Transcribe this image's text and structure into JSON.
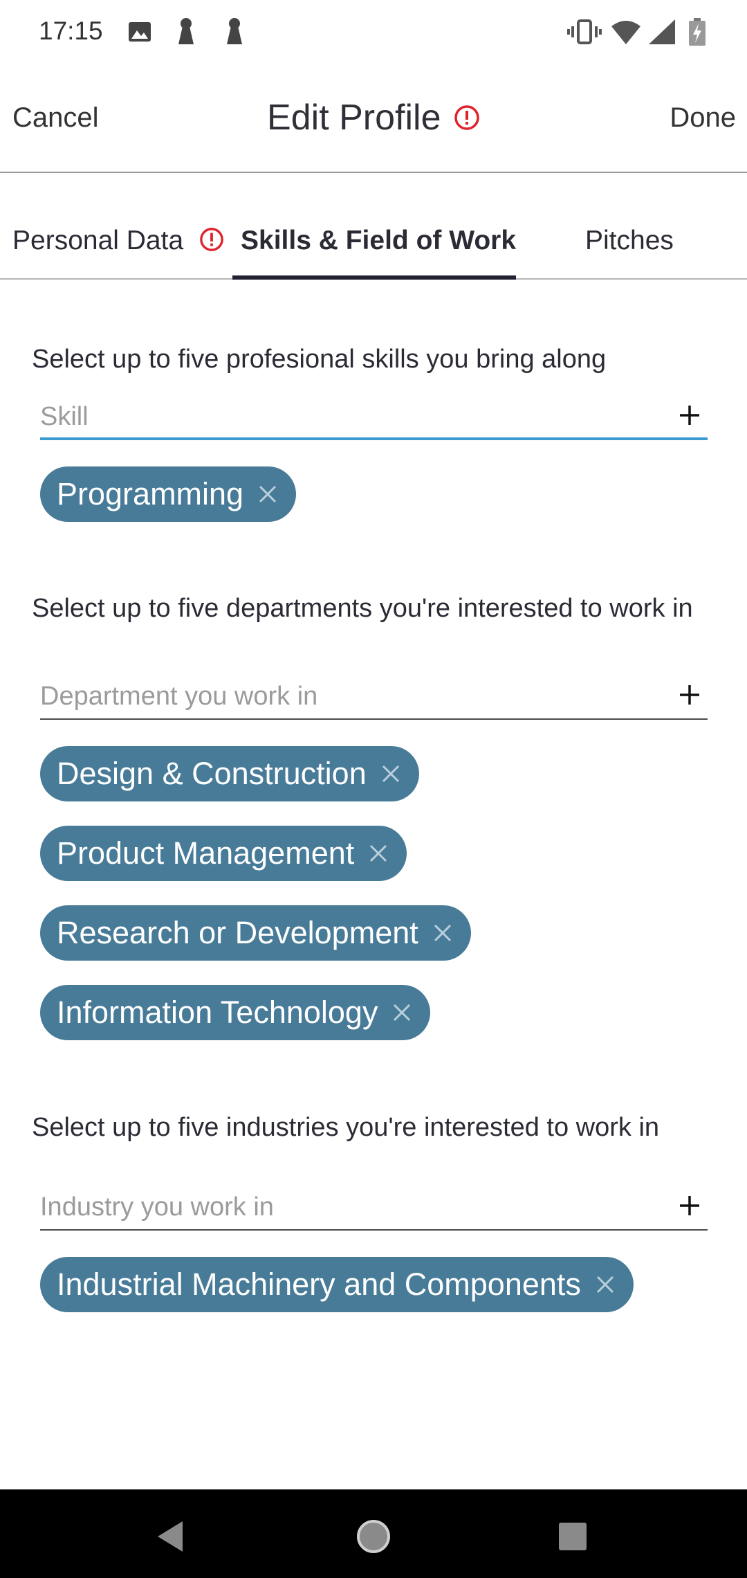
{
  "status_bar": {
    "time": "17:15",
    "icons": [
      "gallery-icon",
      "key-icon",
      "key-icon",
      "vibrate-icon",
      "wifi-icon",
      "signal-icon",
      "battery-icon"
    ]
  },
  "header": {
    "cancel_label": "Cancel",
    "title": "Edit Profile",
    "done_label": "Done",
    "alert_color": "#e0202a"
  },
  "tabs": [
    {
      "label": "Personal Data",
      "has_alert": true,
      "active": false
    },
    {
      "label": "Skills & Field of Work",
      "has_alert": false,
      "active": true
    },
    {
      "label": "Pitches",
      "has_alert": false,
      "active": false
    }
  ],
  "skills": {
    "label": "Select up to five profesional skills you bring along",
    "placeholder": "Skill",
    "chips": [
      "Programming"
    ]
  },
  "departments": {
    "label": "Select up to five departments you're interested to work in",
    "placeholder": "Department you work in",
    "chips": [
      "Design & Construction",
      "Product Management",
      "Research or Development",
      "Information Technology"
    ]
  },
  "industries": {
    "label": "Select up to five industries you're interested to work in",
    "placeholder": "Industry you work in",
    "chips": [
      "Industrial Machinery and Components"
    ]
  },
  "colors": {
    "chip_bg": "#477b98",
    "active_field_underline": "#3b9bd0",
    "tab_indicator": "#222233"
  }
}
